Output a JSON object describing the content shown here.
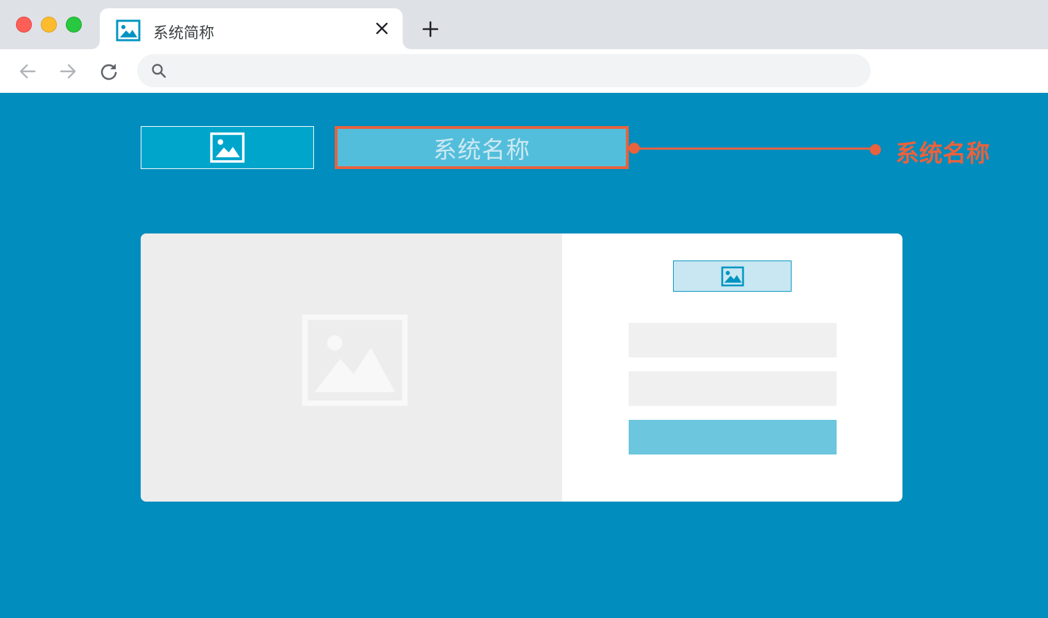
{
  "browser": {
    "tab": {
      "title": "系统简称",
      "favicon_icon": "image-icon",
      "close_icon": "close-icon"
    },
    "new_tab_icon": "plus-icon",
    "toolbar": {
      "back_icon": "arrow-left-icon",
      "forward_icon": "arrow-right-icon",
      "reload_icon": "reload-icon",
      "search_icon": "search-icon",
      "address_value": ""
    }
  },
  "page": {
    "background_color": "#018dbd",
    "header": {
      "logo_icon": "image-icon",
      "system_name": "系统名称"
    },
    "annotation": {
      "label": "系统名称",
      "color": "#e9623e"
    },
    "login_card": {
      "hero_image_icon": "image-placeholder-icon",
      "logo_icon": "image-icon",
      "username_value": "",
      "password_value": "",
      "submit_label": "",
      "submit_color": "#6bc6de"
    }
  }
}
